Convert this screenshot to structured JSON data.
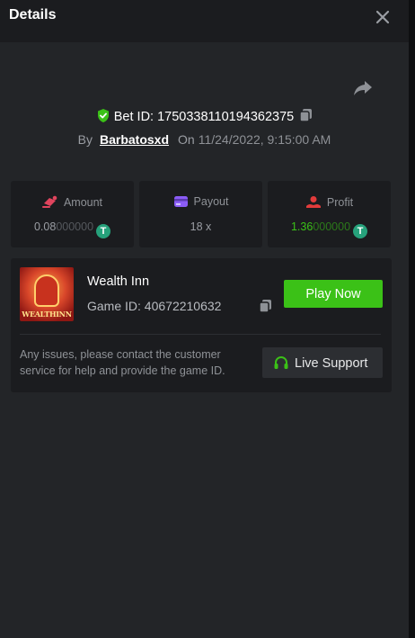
{
  "header": {
    "title": "Details"
  },
  "bet": {
    "id_label": "Bet ID: 1750338110194362375",
    "by_label": "By",
    "username": "Barbatosxd",
    "on_label": "On",
    "datetime": "11/24/2022, 9:15:00 AM"
  },
  "stats": [
    {
      "label": "Amount",
      "value_main": "0.08",
      "value_tail": "000000",
      "icon": "amount-icon",
      "value_color": "#9a9da3"
    },
    {
      "label": "Payout",
      "value": "18 x",
      "icon": "payout-icon"
    },
    {
      "label": "Profit",
      "value_main": "1.36",
      "value_tail": "000000",
      "icon": "profit-icon",
      "value_color": "#3bc117"
    }
  ],
  "game": {
    "name": "Wealth Inn",
    "id_label": "Game ID: 40672210632",
    "thumb_text": "WEALTHINN",
    "play_label": "Play Now",
    "note": "Any issues, please contact the customer service for help and provide the game ID.",
    "support_label": "Live Support"
  },
  "colors": {
    "accent": "#3bc117",
    "coin": "#26a17b",
    "amount_icon": "#e0445d",
    "payout_icon": "#8b5cf6",
    "profit_icon": "#e23b3b"
  }
}
